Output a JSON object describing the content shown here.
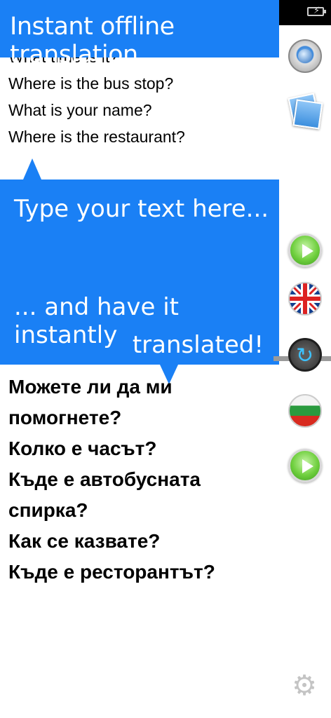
{
  "banner": {
    "title": "Instant offline translation"
  },
  "source": {
    "lines": [
      "What time is it?",
      "Where is the bus stop?",
      "What is your name?",
      "Where is the restaurant?"
    ]
  },
  "callout": {
    "line1": "Type your text here...",
    "line2": "... and have it instantly",
    "line3": "translated!"
  },
  "target": {
    "lines": [
      "Можете ли да ми",
      "помогнете?",
      "Колко е часът?",
      "Къде е автобусната",
      "спирка?",
      "Как се казвате?",
      "Къде е ресторантът?"
    ]
  },
  "sidebar": {
    "icons": [
      "record-icon",
      "photo-icon",
      "play-icon",
      "uk-flag-icon",
      "swap-icon",
      "bulgaria-flag-icon",
      "play-icon",
      "gear-icon"
    ]
  },
  "colors": {
    "accent": "#1a80f5",
    "status_bar": "#000000"
  }
}
